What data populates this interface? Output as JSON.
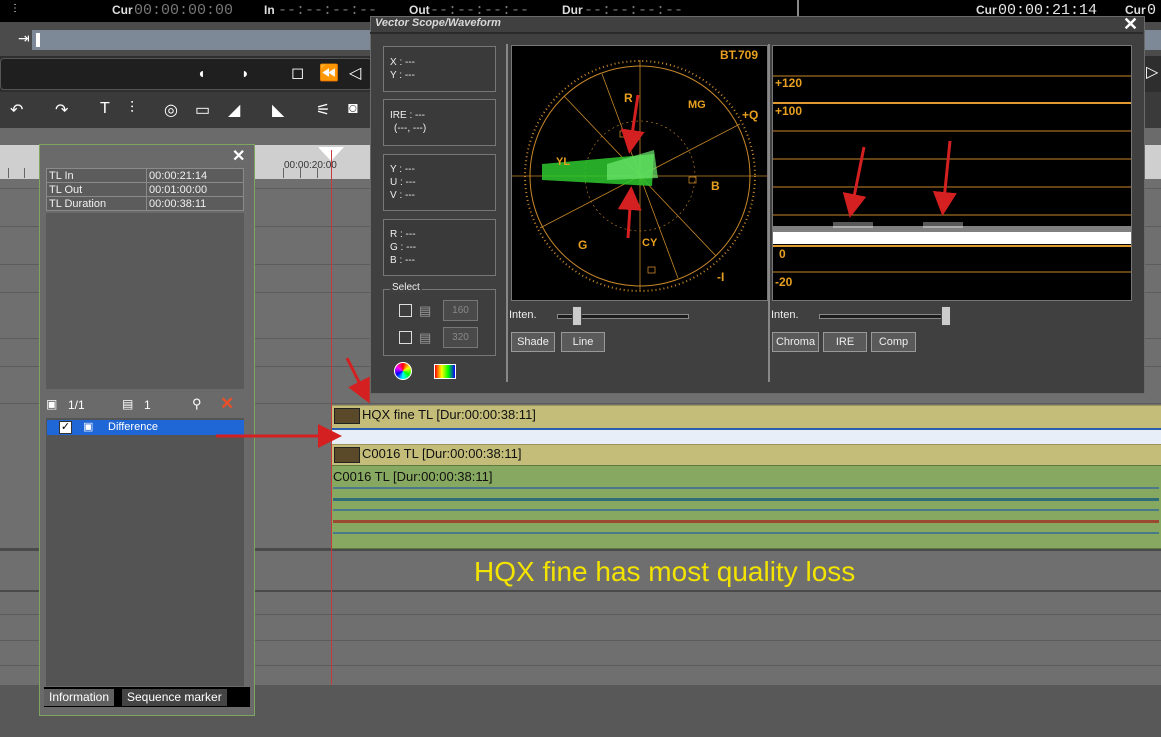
{
  "transport": {
    "cur_label": "Cur",
    "cur_value": "00:00:00:00",
    "in_label": "In",
    "in_value": "--:--:--:--",
    "out_label": "Out",
    "out_value": "--:--:--:--",
    "dur_label": "Dur",
    "dur_value": "--:--:--:--",
    "cur2_label": "Cur",
    "cur2_value": "00:00:21:14",
    "cur3_label": "Cur",
    "cur3_value": "0"
  },
  "ruler": {
    "timecode": "00:00:20:00"
  },
  "info_panel": {
    "rows": [
      {
        "label": "TL In",
        "value": "00:00:21:14"
      },
      {
        "label": "TL Out",
        "value": "00:01:00:00"
      },
      {
        "label": "TL Duration",
        "value": "00:00:38:11"
      }
    ],
    "layer_count": "1/1",
    "layer_number": "1",
    "layer_item": "Difference",
    "tabs": [
      "Information",
      "Sequence marker"
    ]
  },
  "scope": {
    "title": "Vector Scope/Waveform",
    "xy": [
      "X : ---",
      "Y : ---"
    ],
    "ire": [
      "IRE : ---",
      "(---, ---)"
    ],
    "yuv": [
      "Y : ---",
      "U : ---",
      "V : ---"
    ],
    "rgb": [
      "R : ---",
      "G : ---",
      "B : ---"
    ],
    "select_label": "Select",
    "select_values": [
      "160",
      "320"
    ],
    "vector_labels": {
      "standard": "BT.709",
      "R": "R",
      "MG": "MG",
      "Q": "+Q",
      "YL": "YL",
      "B": "B",
      "G": "G",
      "CY": "CY",
      "I": "-I"
    },
    "waveform_labels": [
      "+120",
      "+100",
      "0",
      "-20"
    ],
    "inten_label": "Inten.",
    "inten_label2": "Inten.",
    "buttons_left": [
      "Shade",
      "Line"
    ],
    "buttons_right": [
      "Chroma",
      "IRE",
      "Comp"
    ]
  },
  "clips": {
    "video1": "HQX fine  TL [Dur:00:00:38:11]",
    "video2": "C0016  TL [Dur:00:00:38:11]",
    "audio": "C0016  TL [Dur:00:00:38:11]"
  },
  "annotation": "HQX fine has most quality loss",
  "colors": {
    "annotation": "#f3e300",
    "arrow": "#d42020",
    "selection": "#1f66d6",
    "scope_trace": "#18c418"
  }
}
